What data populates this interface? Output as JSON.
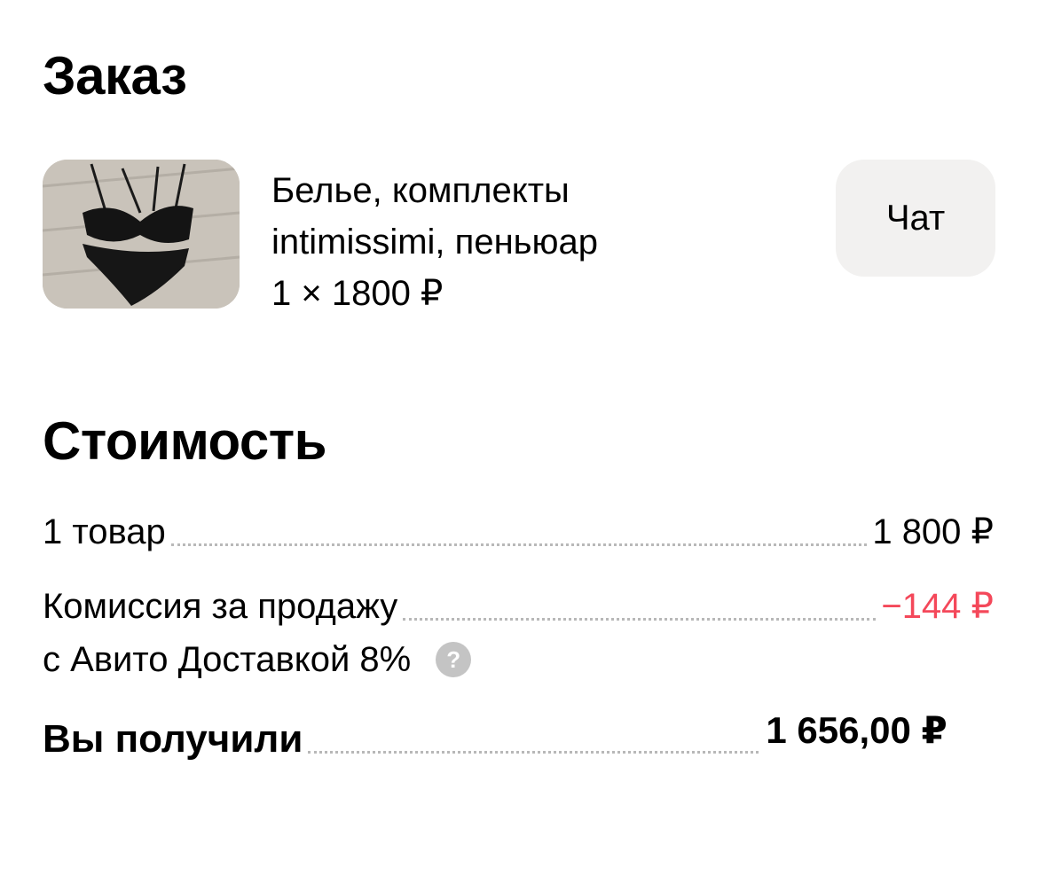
{
  "order": {
    "title": "Заказ",
    "product": {
      "name_line1": "Белье, комплекты",
      "name_line2": "intimissimi, пеньюар",
      "qty_price": "1 × 1800 ₽",
      "image_icon": "lingerie-photo"
    },
    "chat_label": "Чат"
  },
  "cost": {
    "title": "Стоимость",
    "goods_label": "1 товар",
    "goods_value": "1 800 ₽",
    "commission_label_line1": "Комиссия за продажу",
    "commission_label_line2": "с Авито Доставкой 8%",
    "commission_value": "−144 ₽",
    "help_icon": "?",
    "total_label": "Вы получили",
    "total_value": "1 656,00 ₽"
  },
  "colors": {
    "negative": "#f4485a",
    "chat_button_bg": "#f2f1f0",
    "help_icon_bg": "#c4c4c4"
  }
}
